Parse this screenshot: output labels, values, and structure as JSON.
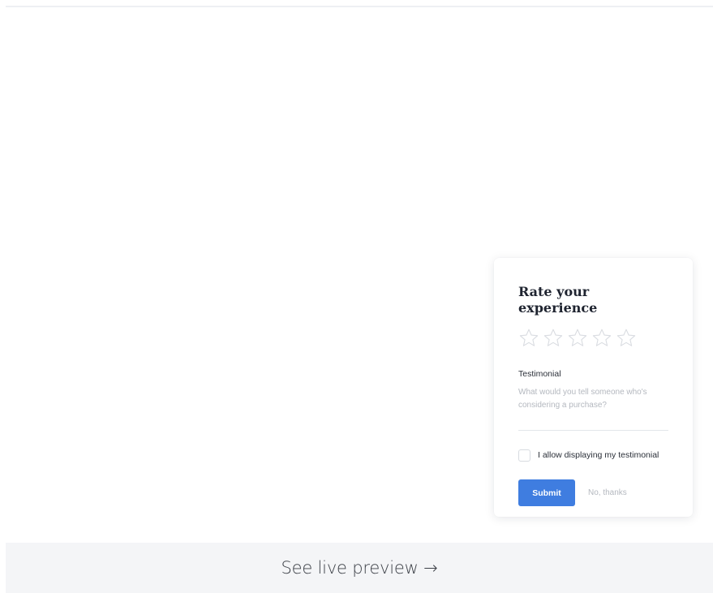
{
  "widget": {
    "title": "Rate your experience",
    "rating": {
      "max": 5,
      "value": 0,
      "icon": "star-outline-icon",
      "color": "#d9dce1"
    },
    "testimonial": {
      "label": "Testimonial",
      "value": "",
      "placeholder": "What would you tell someone who's considering a purchase?"
    },
    "consent": {
      "label": "I allow displaying my testimonial",
      "checked": false
    },
    "submit_label": "Submit",
    "cancel_label": "No, thanks",
    "accent_color": "#3f7de0"
  },
  "footer": {
    "link_label": "See live preview →"
  }
}
